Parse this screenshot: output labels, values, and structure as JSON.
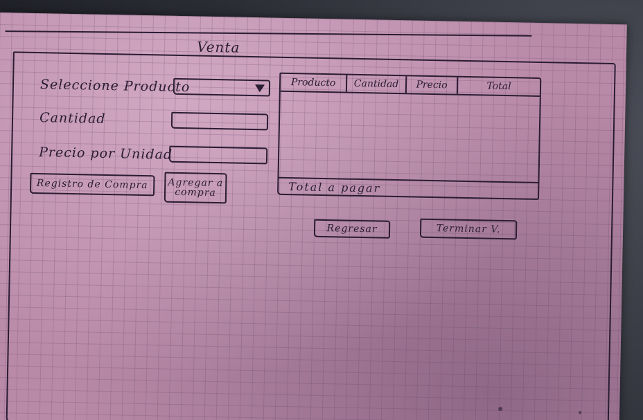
{
  "window": {
    "title": "Venta"
  },
  "form": {
    "producto_label": "Seleccione Producto",
    "producto_value": "",
    "cantidad_label": "Cantidad",
    "cantidad_value": "",
    "precio_label": "Precio por Unidad",
    "precio_value": ""
  },
  "buttons": {
    "registro": "Registro de Compra",
    "agregar": "Agregar a compra",
    "regresar": "Regresar",
    "terminar": "Terminar V."
  },
  "table": {
    "columns": [
      "Producto",
      "Cantidad",
      "Precio",
      "Total"
    ],
    "rows": [],
    "total_label": "Total a pagar"
  },
  "colors": {
    "ink": "#2a1c33",
    "paper": "#b98aa8",
    "background": "#2e3038"
  },
  "icons": {
    "dropdown": "triangle-down-icon"
  }
}
